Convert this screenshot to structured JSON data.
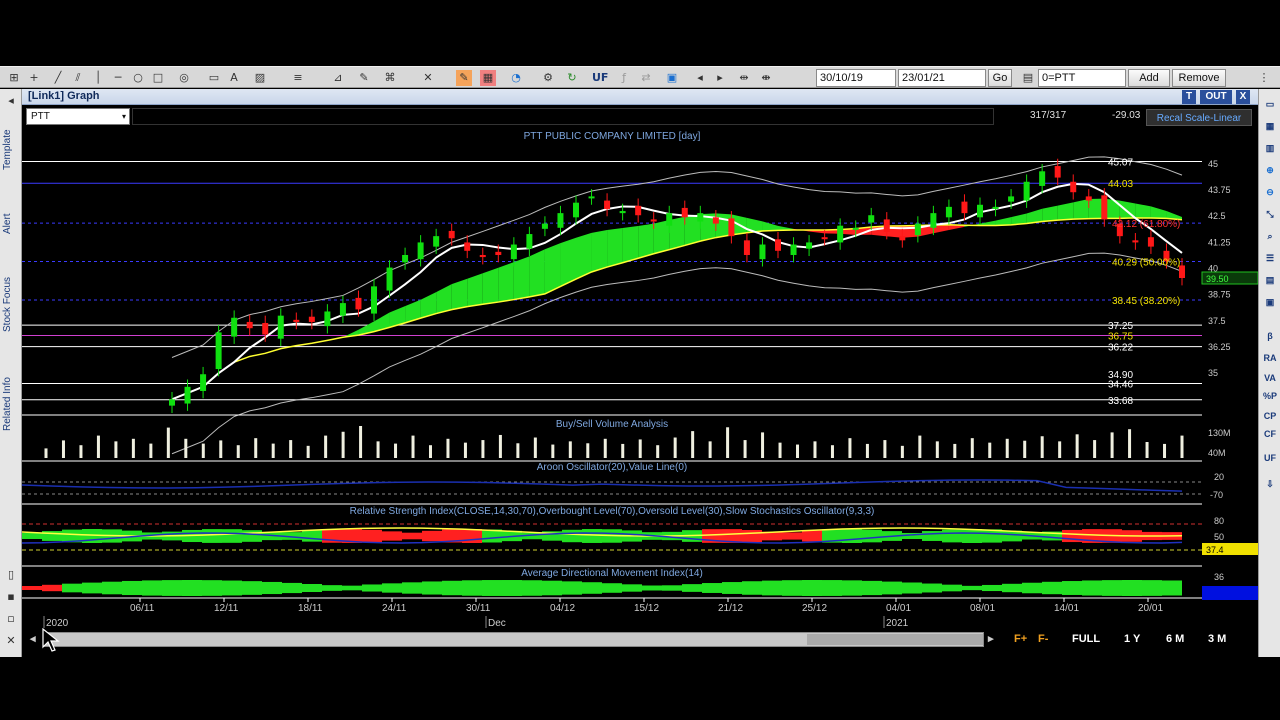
{
  "toolbar": {
    "date_from": "30/10/19",
    "date_to": "23/01/21",
    "go_label": "Go",
    "symbol_select": "0=PTT",
    "add_label": "Add",
    "remove_label": "Remove",
    "uf_label": "UF"
  },
  "window": {
    "title": "[Link1] Graph",
    "t_label": "T",
    "out_label": "OUT",
    "close_label": "X"
  },
  "symbol_row": {
    "symbol": "PTT",
    "count": "317/317",
    "change": "-29.03",
    "recal_label": "Recal Scale-Linear"
  },
  "left_tabs": [
    "Template",
    "Alert",
    "Stock Focus",
    "Related Info"
  ],
  "right_icons": [
    "β",
    "RA",
    "VA",
    "%P",
    "CP",
    "CF",
    "UF"
  ],
  "chart_data": [
    {
      "type": "candlestick",
      "title": "PTT PUBLIC COMPANY LIMITED [day]",
      "ylim": [
        33.0,
        46.0
      ],
      "y_ticks": [
        "45",
        "43.75",
        "42.5",
        "41.25",
        "40",
        "38.75",
        "37.5",
        "36.25",
        "35"
      ],
      "price_labels": {
        "high": "45.07",
        "level_44": "44.03",
        "fib_618": "42.12 (61.80%)",
        "fib_50": "40.29 (50.00%)",
        "last": "39.50",
        "fib_382": "38.45 (38.20%)",
        "l3725": "37.25",
        "l3675": "36.75",
        "l3622": "36.22",
        "l3490": "34.90",
        "l3446": "34.46",
        "low": "33.68"
      },
      "close": [
        33.7,
        34.3,
        34.9,
        36.9,
        37.6,
        37.1,
        36.8,
        37.7,
        37.4,
        37.4,
        37.9,
        38.3,
        38.0,
        39.1,
        40.0,
        40.6,
        41.2,
        41.5,
        41.4,
        40.8,
        40.5,
        40.6,
        41.1,
        41.6,
        42.1,
        42.6,
        43.1,
        43.4,
        42.8,
        42.7,
        42.5,
        42.2,
        42.6,
        42.4,
        42.6,
        42.1,
        41.5,
        40.6,
        41.1,
        40.8,
        41.1,
        41.2,
        41.4,
        42.0,
        41.9,
        42.5,
        41.7,
        41.3,
        42.1,
        42.6,
        42.9,
        42.6,
        43.0,
        42.9,
        43.4,
        44.1,
        44.6,
        44.3,
        43.6,
        43.2,
        42.3,
        41.5,
        41.2,
        41.0,
        40.3,
        39.5
      ]
    },
    {
      "type": "bar",
      "title": "Buy/Sell Volume Analysis",
      "y_ticks": [
        "130M",
        "40M"
      ],
      "values": [
        30,
        55,
        40,
        70,
        52,
        60,
        45,
        95,
        60,
        45,
        55,
        40,
        62,
        45,
        56,
        38,
        70,
        82,
        100,
        52,
        45,
        70,
        40,
        60,
        48,
        56,
        72,
        46,
        64,
        42,
        52,
        46,
        60,
        44,
        58,
        40,
        64,
        84,
        52,
        96,
        56,
        80,
        48,
        42,
        52,
        40,
        62,
        44,
        56,
        38,
        70,
        52,
        44,
        62,
        48,
        60,
        54,
        68,
        52,
        74,
        56,
        80,
        90,
        50,
        44,
        70
      ]
    },
    {
      "type": "line",
      "title": "Aroon Oscillator(20),Value Line(0)",
      "y_ticks": [
        "20",
        "-70"
      ]
    },
    {
      "type": "line",
      "title": "Relative Strength Index(CLOSE,14,30,70),Overbought Level(70),Oversold Level(30),Slow Stochastics Oscillator(9,3,3)",
      "y_ticks": [
        "80",
        "50",
        "37.4"
      ]
    },
    {
      "type": "area",
      "title": "Average Directional Movement Index(14)",
      "y_ticks": [
        "36"
      ]
    }
  ],
  "x_axis": {
    "dates": [
      "06/11",
      "12/11",
      "18/11",
      "24/11",
      "30/11",
      "04/12",
      "15/12",
      "21/12",
      "25/12",
      "04/01",
      "08/01",
      "14/01",
      "20/01"
    ],
    "periods": [
      "2020",
      "Dec",
      "2021"
    ]
  },
  "range_buttons": [
    "F+",
    "F-",
    "FULL",
    "1 Y",
    "6 M",
    "3 M"
  ]
}
